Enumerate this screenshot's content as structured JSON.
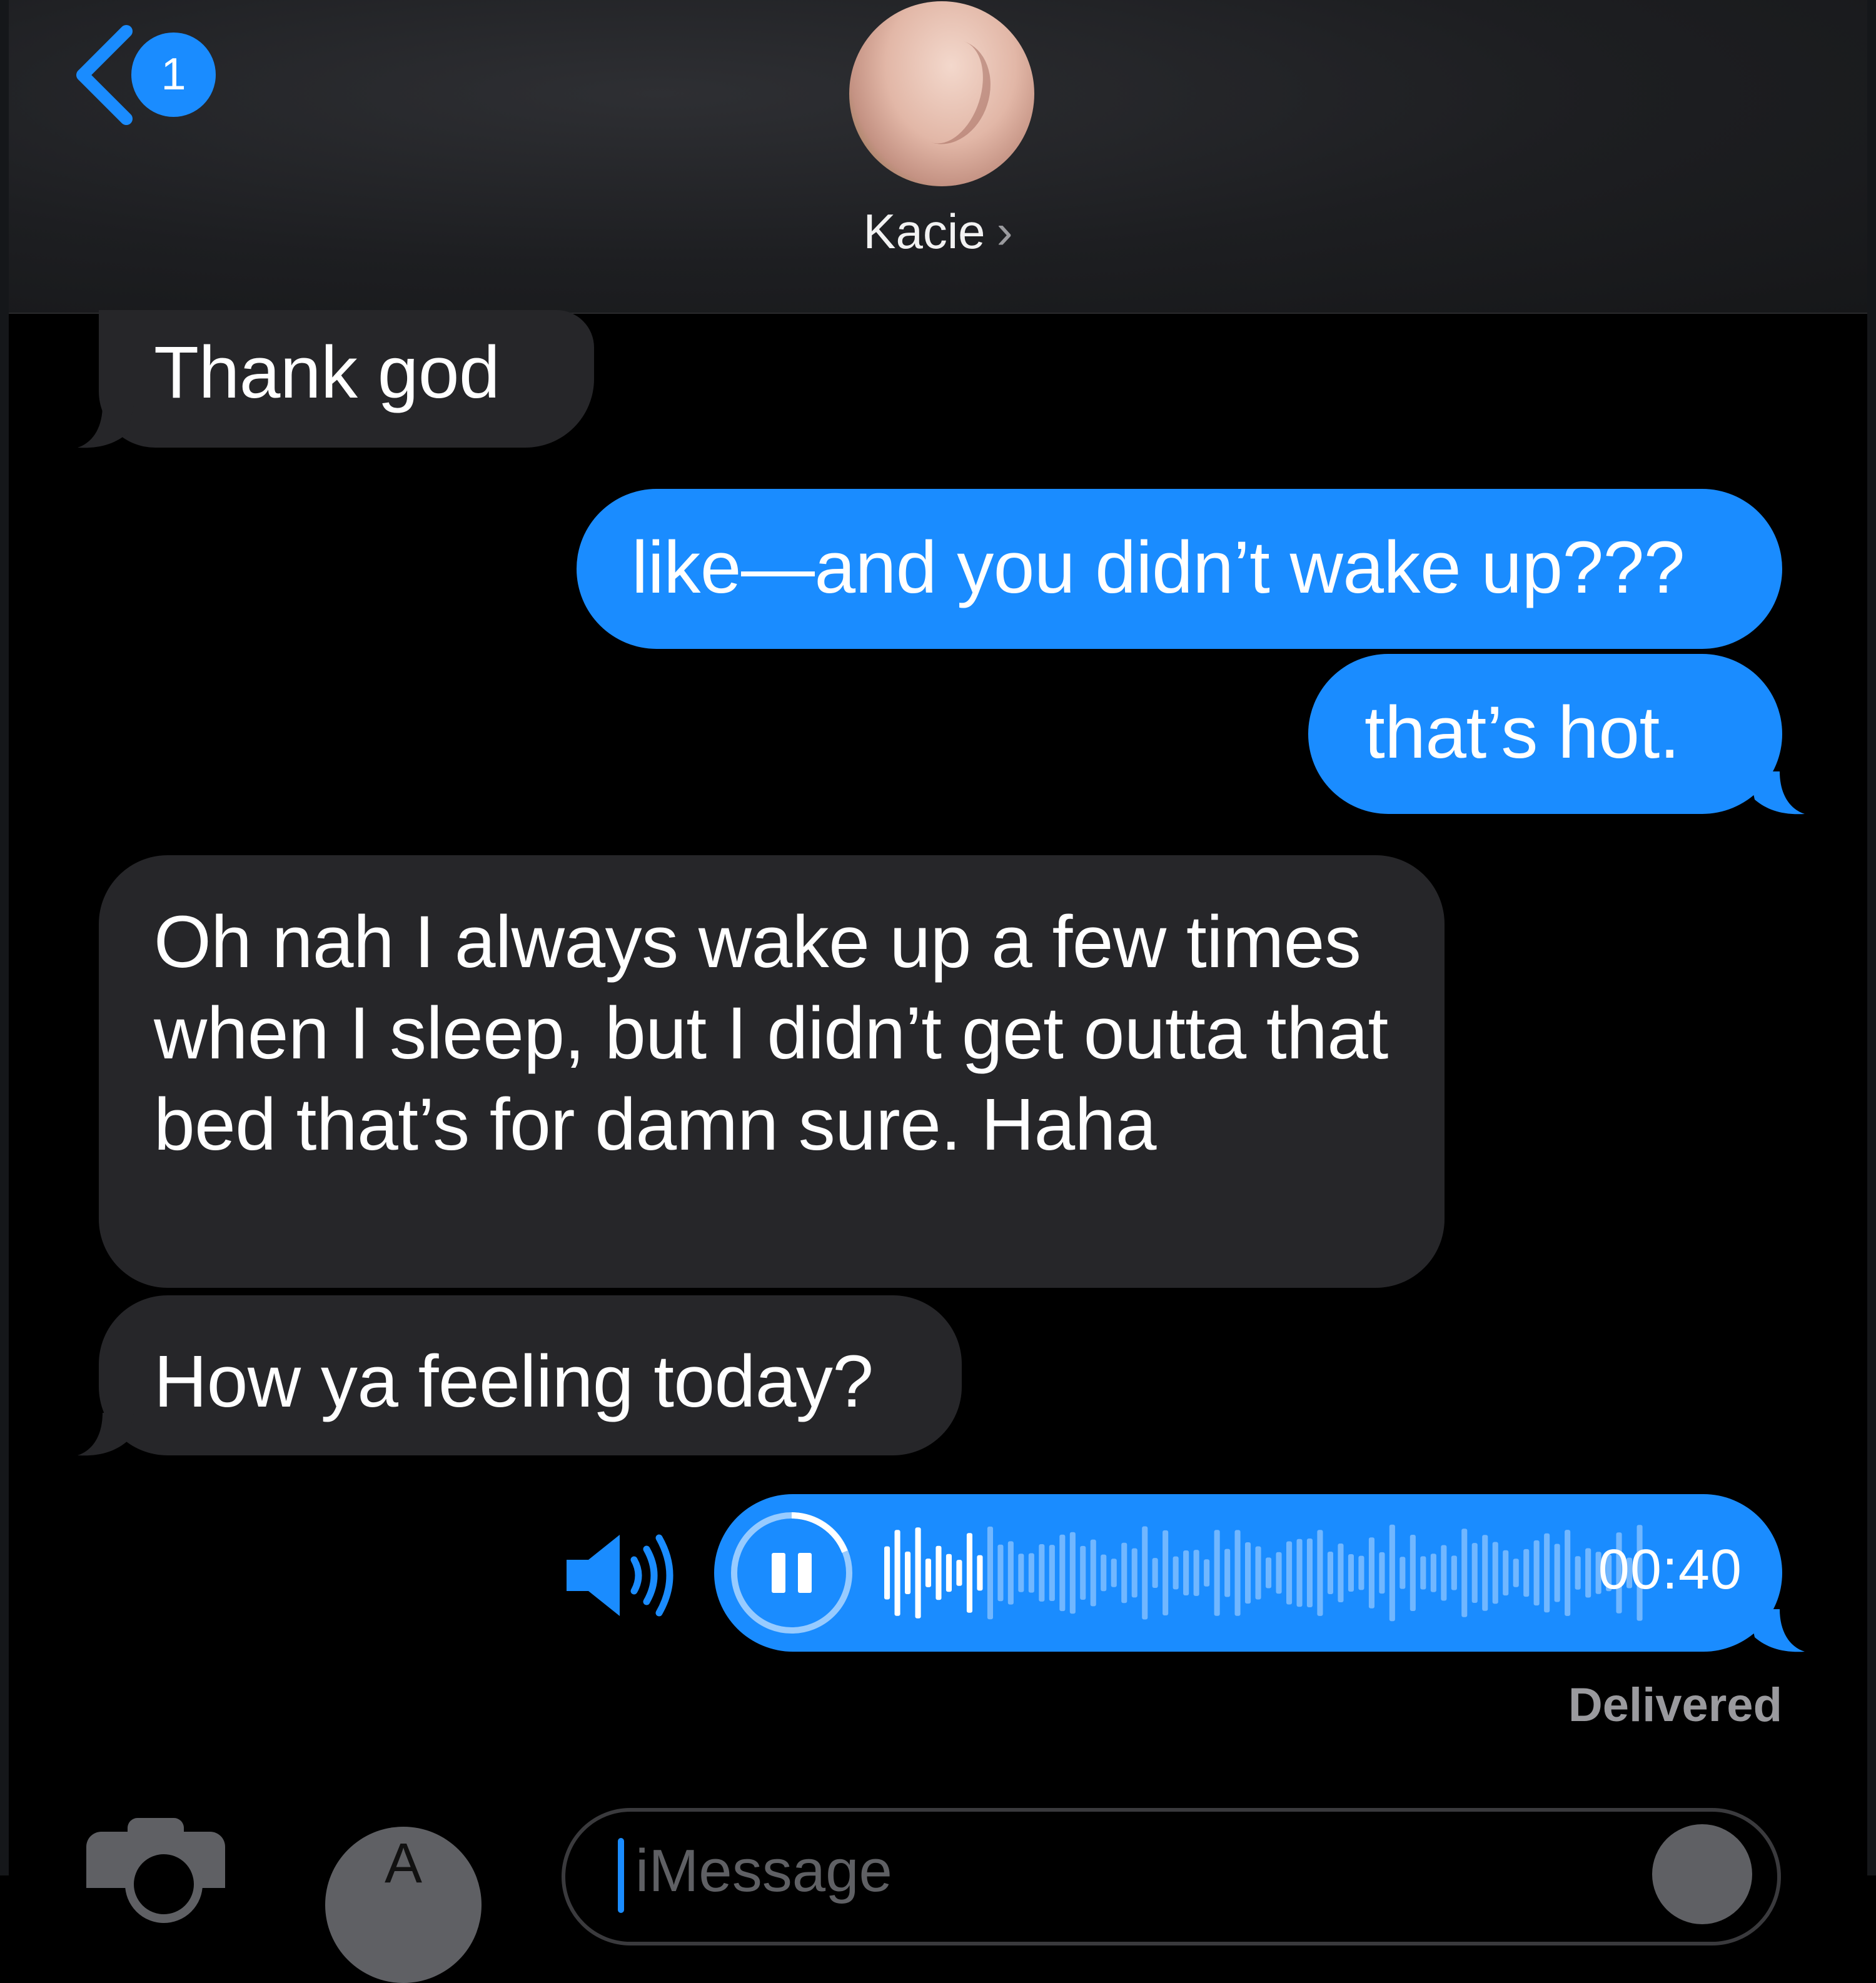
{
  "header": {
    "back_badge": "1",
    "contact_name": "Kacie",
    "contact_chevron": "›"
  },
  "messages": [
    {
      "direction": "incoming",
      "text": "Thank god"
    },
    {
      "direction": "outgoing",
      "text": "like—and you didn’t wake up???"
    },
    {
      "direction": "outgoing",
      "text": "that’s hot."
    },
    {
      "direction": "incoming",
      "text": "Oh nah I always wake up a few times when I sleep, but I didn’t get outta that bed that’s for damn sure. Haha"
    },
    {
      "direction": "incoming",
      "text": "How ya feeling today?"
    }
  ],
  "audio_message": {
    "duration": "00:40",
    "state": "playing",
    "progress_fraction": 0.14
  },
  "status": "Delivered",
  "composer": {
    "placeholder": "iMessage",
    "icons": [
      "camera-icon",
      "app-store-icon",
      "audio-record-icon"
    ]
  },
  "colors": {
    "outgoing_bubble": "#1a8cff",
    "incoming_bubble": "#262629",
    "background": "#000000",
    "header_background": "#1d1e21"
  }
}
